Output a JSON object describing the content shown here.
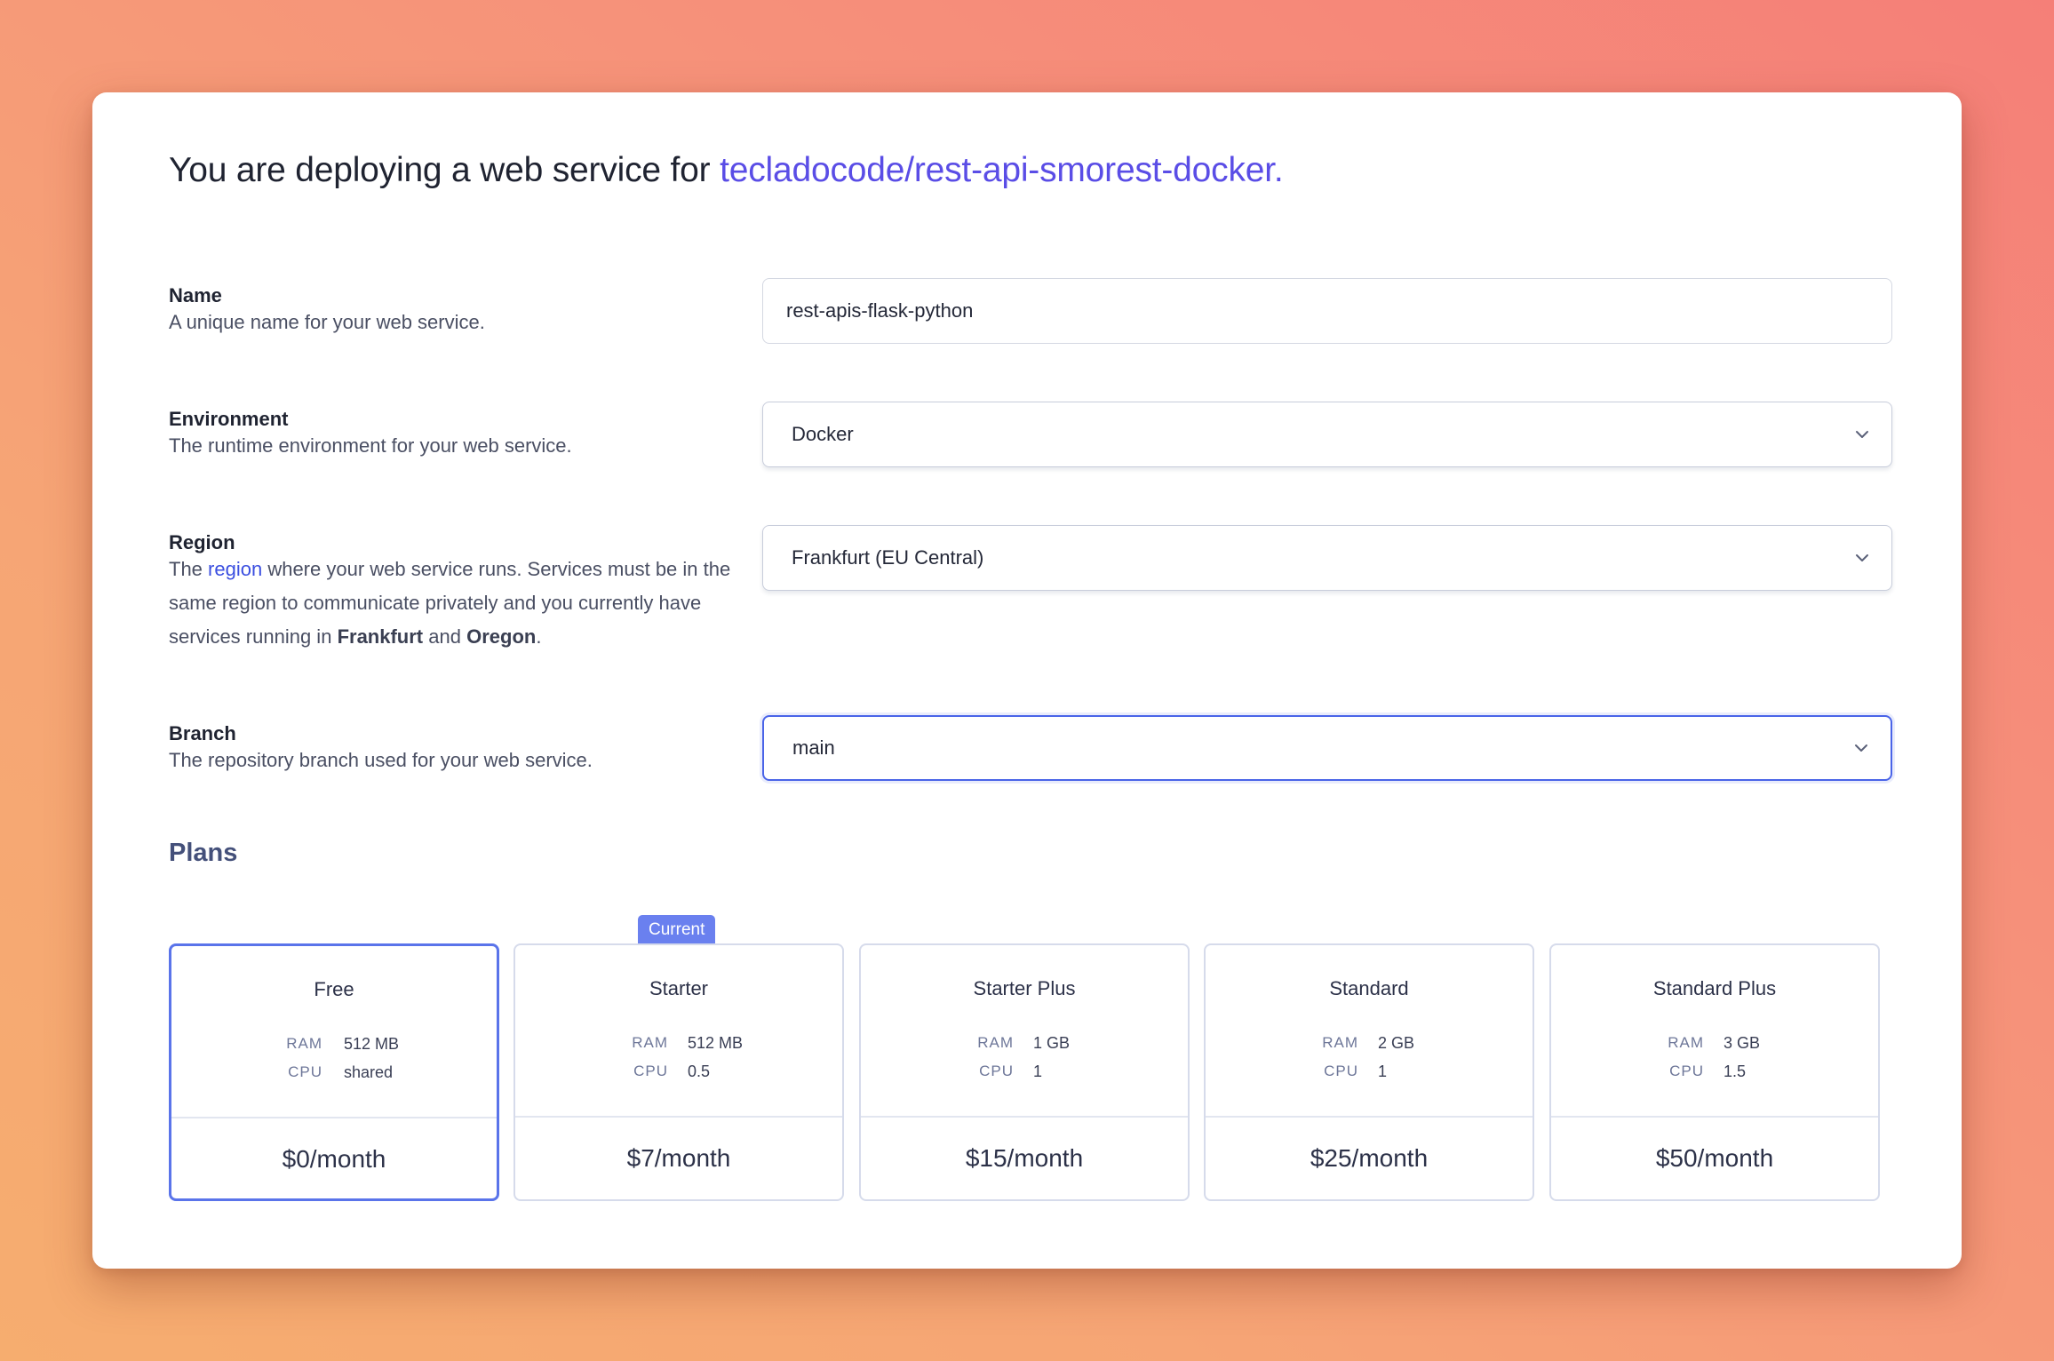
{
  "header": {
    "prefix": "You are deploying a web service for",
    "repo": "tecladocode/rest-api-smorest-docker."
  },
  "fields": {
    "name": {
      "label": "Name",
      "description": "A unique name for your web service.",
      "value": "rest-apis-flask-python"
    },
    "environment": {
      "label": "Environment",
      "description": "The runtime environment for your web service.",
      "value": "Docker"
    },
    "region": {
      "label": "Region",
      "desc_before_link": "The",
      "link": "region",
      "desc_after_link": "where your web service runs. Services must be in the same region to communicate privately and you currently have services running in",
      "region_a": "Frankfurt",
      "conj": "and",
      "region_b": "Oregon",
      "period": ".",
      "value": "Frankfurt (EU Central)"
    },
    "branch": {
      "label": "Branch",
      "description": "The repository branch used for your web service.",
      "value": "main"
    }
  },
  "plans": {
    "title": "Plans",
    "current_badge": "Current",
    "selected": "Free",
    "current": "Starter",
    "items": [
      {
        "name": "Free",
        "ram_label": "RAM",
        "ram": "512 MB",
        "cpu_label": "CPU",
        "cpu": "shared",
        "price": "$0/month"
      },
      {
        "name": "Starter",
        "ram_label": "RAM",
        "ram": "512 MB",
        "cpu_label": "CPU",
        "cpu": "0.5",
        "price": "$7/month"
      },
      {
        "name": "Starter Plus",
        "ram_label": "RAM",
        "ram": "1 GB",
        "cpu_label": "CPU",
        "cpu": "1",
        "price": "$15/month"
      },
      {
        "name": "Standard",
        "ram_label": "RAM",
        "ram": "2 GB",
        "cpu_label": "CPU",
        "cpu": "1",
        "price": "$25/month"
      },
      {
        "name": "Standard Plus",
        "ram_label": "RAM",
        "ram": "3 GB",
        "cpu_label": "CPU",
        "cpu": "1.5",
        "price": "$50/month"
      }
    ]
  },
  "icons": {
    "select_chevron": "chevron-down-icon"
  },
  "colors": {
    "accent": "#4a64e8",
    "repo_link": "#5a4de6",
    "badge": "#6a80ef",
    "plans_title": "#44507a"
  }
}
